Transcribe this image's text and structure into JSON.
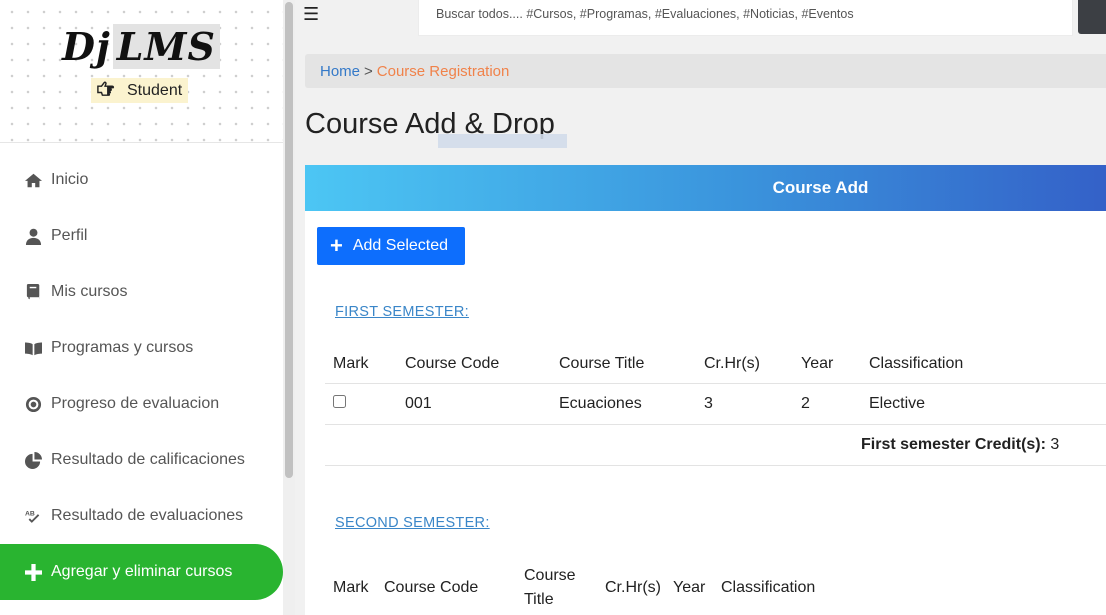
{
  "sidebar": {
    "logo_dj": "Dj",
    "logo_lms": "LMS",
    "role": "Student",
    "items": [
      {
        "label": "Inicio",
        "icon": "home-icon"
      },
      {
        "label": "Perfil",
        "icon": "user-icon"
      },
      {
        "label": "Mis cursos",
        "icon": "book-icon"
      },
      {
        "label": "Programas y cursos",
        "icon": "open-book-icon"
      },
      {
        "label": "Progreso de evaluacion",
        "icon": "target-icon"
      },
      {
        "label": "Resultado de calificaciones",
        "icon": "chart-pie-icon"
      },
      {
        "label": "Resultado de evaluaciones",
        "icon": "spell-check-icon"
      },
      {
        "label": "Agregar y eliminar cursos",
        "icon": "plus-icon",
        "active": true
      }
    ]
  },
  "topbar": {
    "search_placeholder": "Buscar todos.... #Cursos, #Programas, #Evaluaciones, #Noticias, #Eventos"
  },
  "breadcrumb": {
    "home": "Home",
    "separator": ">",
    "current": "Course Registration"
  },
  "page": {
    "title": "Course Add & Drop"
  },
  "panel": {
    "header": "Course Add",
    "add_button": "Add Selected",
    "first_semester": {
      "link": "FIRST SEMESTER:",
      "columns": [
        "Mark",
        "Course Code",
        "Course Title",
        "Cr.Hr(s)",
        "Year",
        "Classification"
      ],
      "rows": [
        {
          "code": "001",
          "title": "Ecuaciones",
          "credits": "3",
          "year": "2",
          "classification": "Elective",
          "checked": false
        }
      ],
      "total_label": "First semester Credit(s):",
      "total_value": "3"
    },
    "second_semester": {
      "link": "SECOND SEMESTER:",
      "columns": [
        "Mark",
        "Course Code",
        "Course Title",
        "Cr.Hr(s)",
        "Year",
        "Classification"
      ]
    }
  },
  "colors": {
    "accent_green": "#29b430",
    "primary_blue": "#0d6efd",
    "breadcrumb_current": "#f0824a"
  }
}
